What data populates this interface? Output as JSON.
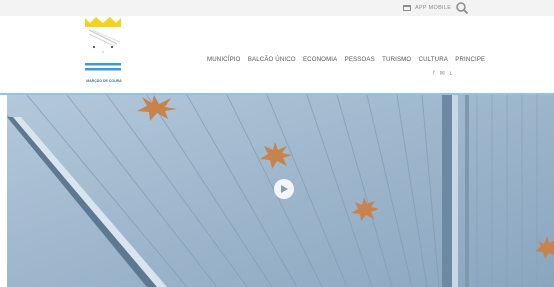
{
  "topbar": {
    "app_mobile_label": "APP MOBILE"
  },
  "logo": {
    "text": "MARÇÃO DE COURA"
  },
  "nav": {
    "items": [
      {
        "label": "MUNICÍPIO"
      },
      {
        "label": "BALCÃO ÚNICO"
      },
      {
        "label": "ECONOMIA"
      },
      {
        "label": "PESSOAS"
      },
      {
        "label": "TURISMO"
      },
      {
        "label": "CULTURA"
      },
      {
        "label": "PRINCIPE"
      }
    ]
  },
  "social": {
    "icons": [
      "facebook-icon",
      "email-icon",
      "rss-icon"
    ],
    "glyphs": [
      "f",
      "✉",
      "ʟ"
    ]
  },
  "colors": {
    "accent": "#8fc4e6",
    "logo_blue": "#3b6da3",
    "crown_yellow": "#f6d21e",
    "star_orange": "#c8824b"
  }
}
